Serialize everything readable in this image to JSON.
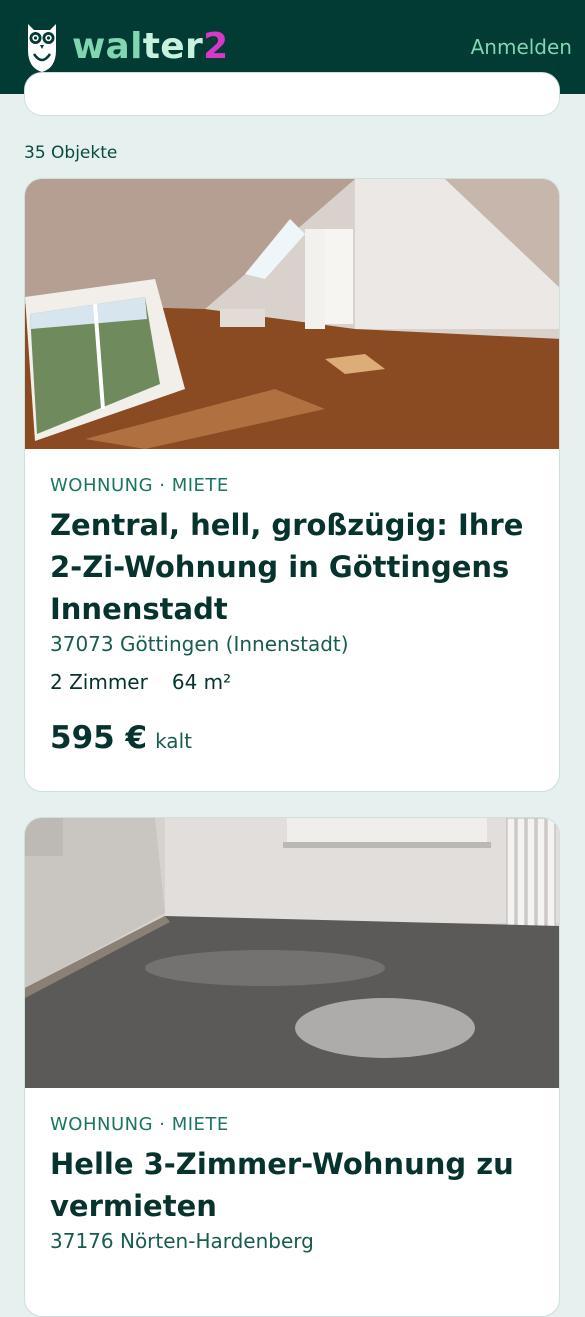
{
  "header": {
    "logo": {
      "part1": "wal",
      "part2": "ter",
      "part3": "2"
    },
    "login_label": "Anmelden"
  },
  "results": {
    "count_label": "35 Objekte"
  },
  "listings": [
    {
      "category": "WOHNUNG · MIETE",
      "title": "Zentral, hell, großzügig: Ihre 2-Zi-Wohnung in Göttingens Innenstadt",
      "address": "37073 Göttingen (Innenstadt)",
      "rooms": "2 Zimmer",
      "area": "64 m²",
      "price": "595 €",
      "price_unit": "kalt"
    },
    {
      "category": "WOHNUNG · MIETE",
      "title": "Helle 3-Zimmer-Wohnung zu vermieten",
      "address": "37176 Nörten-Hardenberg"
    }
  ],
  "colors": {
    "header_bg": "#023a34",
    "accent": "#7fd6b0",
    "logo_pink": "#d838c8",
    "page_bg": "#e6f0ee"
  }
}
